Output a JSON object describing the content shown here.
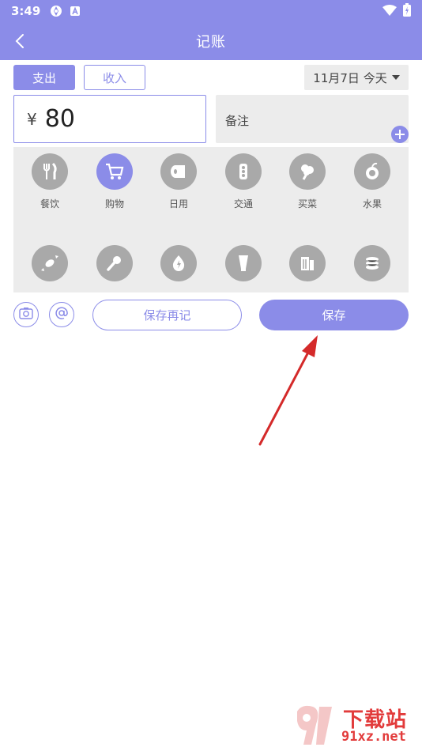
{
  "status_bar": {
    "time": "3:49",
    "icons": [
      "sync-icon",
      "notification-a-icon",
      "wifi-icon",
      "battery-icon"
    ]
  },
  "header": {
    "title": "记账",
    "back_icon": "chevron-left-icon"
  },
  "tabs": {
    "expense": "支出",
    "income": "收入",
    "active": "expense"
  },
  "date": {
    "label": "11月7日 今天"
  },
  "amount": {
    "currency": "¥",
    "value": "80"
  },
  "note": {
    "placeholder": "备注"
  },
  "categories": {
    "row1": [
      {
        "label": "餐饮",
        "icon": "utensils-icon",
        "active": false
      },
      {
        "label": "购物",
        "icon": "cart-icon",
        "active": true
      },
      {
        "label": "日用",
        "icon": "tissue-roll-icon",
        "active": false
      },
      {
        "label": "交通",
        "icon": "traffic-light-icon",
        "active": false
      },
      {
        "label": "买菜",
        "icon": "vegetable-icon",
        "active": false
      },
      {
        "label": "水果",
        "icon": "fruit-icon",
        "active": false
      }
    ],
    "row2": [
      {
        "label": "",
        "icon": "candy-icon",
        "active": false
      },
      {
        "label": "",
        "icon": "microphone-icon",
        "active": false
      },
      {
        "label": "",
        "icon": "water-drop-icon",
        "active": false
      },
      {
        "label": "",
        "icon": "tube-icon",
        "active": false
      },
      {
        "label": "",
        "icon": "building-icon",
        "active": false
      },
      {
        "label": "",
        "icon": "coins-icon",
        "active": false
      }
    ]
  },
  "actions": {
    "camera_icon": "camera-icon",
    "mention_icon": "at-icon",
    "save_again": "保存再记",
    "save": "保存"
  },
  "watermark": {
    "logo_digits": "91",
    "title": "下载站",
    "url": "91xz.net"
  },
  "colors": {
    "accent": "#8b8ce8",
    "panel": "#ececec",
    "icon_gray": "#a9a9a9",
    "arrow": "#d42a2a",
    "watermark": "#e23b3b"
  }
}
